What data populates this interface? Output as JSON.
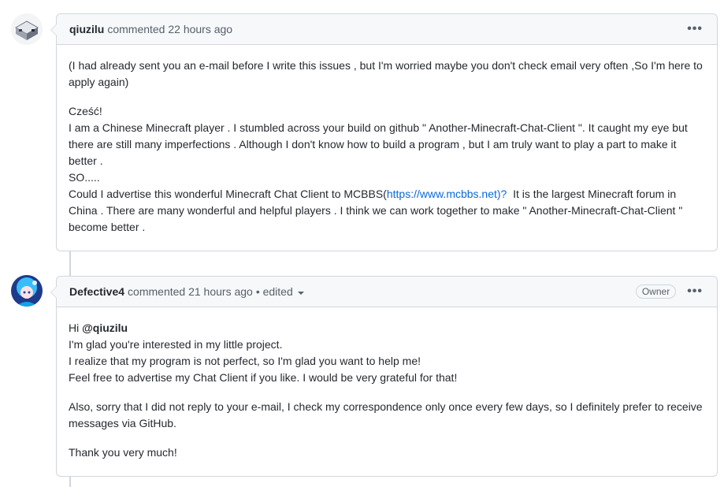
{
  "comments": [
    {
      "author": "qiuzilu",
      "meta": "commented 22 hours ago",
      "menu_icon": "kebab-horizontal-icon",
      "paragraphs": {
        "p1": "(I had already sent you an e-mail before I write this issues , but I'm worried maybe you don't check email very often ,So I'm here to apply again)",
        "greeting": "Cześć!",
        "line1": "I am a Chinese Minecraft player . I stumbled across your build on github \" Another-Minecraft-Chat-Client \". It caught my eye but there are still many imperfections . Although I don't know how to build a program , but I am truly want to play a part to make it better .",
        "so": "SO.....",
        "ask_prefix": "Could I advertise this wonderful Minecraft Chat Client to MCBBS(",
        "ask_link": "https://www.mcbbs.net)?",
        "ask_suffix": "  It is the largest Minecraft forum in China . There are many wonderful and helpful players . I think we can work together to make \" Another-Minecraft-Chat-Client \" become better ."
      }
    },
    {
      "author": "Defective4",
      "meta": "commented 21 hours ago",
      "edited": "• edited",
      "badge": "Owner",
      "menu_icon": "kebab-horizontal-icon",
      "paragraphs": {
        "hi": "Hi ",
        "mention": "@qiuzilu",
        "l1": "I'm glad you're interested in my little project.",
        "l2": "I realize that my program is not perfect, so I'm glad you want to help me!",
        "l3": "Feel free to advertise my Chat Client if you like. I would be very grateful for that!",
        "p2": "Also, sorry that I did not reply to your e-mail, I check my correspondence only once every few days, so I definitely prefer to receive messages via GitHub.",
        "p3": "Thank you very much!"
      }
    }
  ],
  "kebab": "•••",
  "colors": {
    "link": "#0969da",
    "border": "#d0d7de",
    "header_bg": "#f6f8fa"
  }
}
